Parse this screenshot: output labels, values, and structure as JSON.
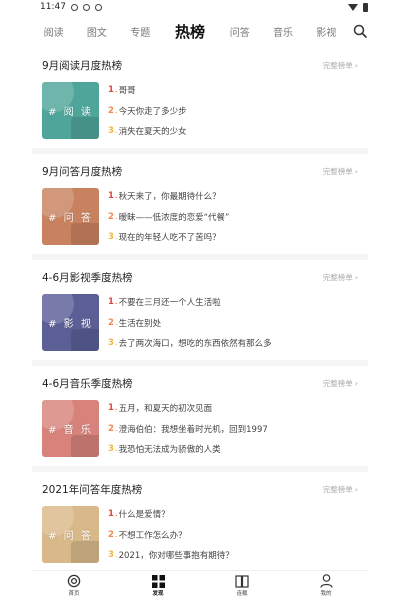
{
  "status_bar": {
    "time": "11:47"
  },
  "top_nav": {
    "tabs": [
      {
        "label": "阅读"
      },
      {
        "label": "图文"
      },
      {
        "label": "专题"
      },
      {
        "label": "热榜",
        "active": true
      },
      {
        "label": "问答"
      },
      {
        "label": "音乐"
      },
      {
        "label": "影视"
      }
    ],
    "search_icon": "search-icon"
  },
  "cards": [
    {
      "title": "9月阅读月度热榜",
      "more": "完整榜单",
      "cover_label": "# 阅 读",
      "cover_color": "#4fa59a",
      "items": [
        {
          "rank": "1",
          "text": "哥哥"
        },
        {
          "rank": "2",
          "text": "今天你走了多少步"
        },
        {
          "rank": "3",
          "text": "消失在夏天的少女"
        }
      ]
    },
    {
      "title": "9月问答月度热榜",
      "more": "完整榜单",
      "cover_label": "# 问 答",
      "cover_color": "#c9825f",
      "items": [
        {
          "rank": "1",
          "text": "秋天来了，你最期待什么？"
        },
        {
          "rank": "2",
          "text": "暧昧——低浓度的恋爱“代餐”"
        },
        {
          "rank": "3",
          "text": "现在的年轻人吃不了苦吗？"
        }
      ]
    },
    {
      "title": "4-6月影视季度热榜",
      "more": "完整榜单",
      "cover_label": "# 影 视",
      "cover_color": "#5b5f96",
      "items": [
        {
          "rank": "1",
          "text": "不要在三月还一个人生活啦"
        },
        {
          "rank": "2",
          "text": "生活在别处"
        },
        {
          "rank": "3",
          "text": "去了两次海口，想吃的东西依然有那么多"
        }
      ]
    },
    {
      "title": "4-6月音乐季度热榜",
      "more": "完整榜单",
      "cover_label": "# 音 乐",
      "cover_color": "#d7837c",
      "items": [
        {
          "rank": "1",
          "text": "五月，和夏天的初次见面"
        },
        {
          "rank": "2",
          "text": "澄海伯伯：我想坐着时光机，回到1997"
        },
        {
          "rank": "3",
          "text": "我恐怕无法成为骄傲的人类"
        }
      ]
    },
    {
      "title": "2021年问答年度热榜",
      "more": "完整榜单",
      "cover_label": "# 问 答",
      "cover_color": "#d9b98a",
      "items": [
        {
          "rank": "1",
          "text": "什么是爱情？"
        },
        {
          "rank": "2",
          "text": "不想工作怎么办？"
        },
        {
          "rank": "3",
          "text": "2021，你对哪些事抱有期待？"
        }
      ]
    }
  ],
  "rank_colors": {
    "1": "#e0483e",
    "2": "#f08a4b",
    "3": "#f2b640"
  },
  "bottom_nav": [
    {
      "label": "首页",
      "icon": "home-icon"
    },
    {
      "label": "发现",
      "icon": "grid-icon",
      "active": true
    },
    {
      "label": "连载",
      "icon": "book-icon"
    },
    {
      "label": "我的",
      "icon": "user-icon"
    }
  ]
}
